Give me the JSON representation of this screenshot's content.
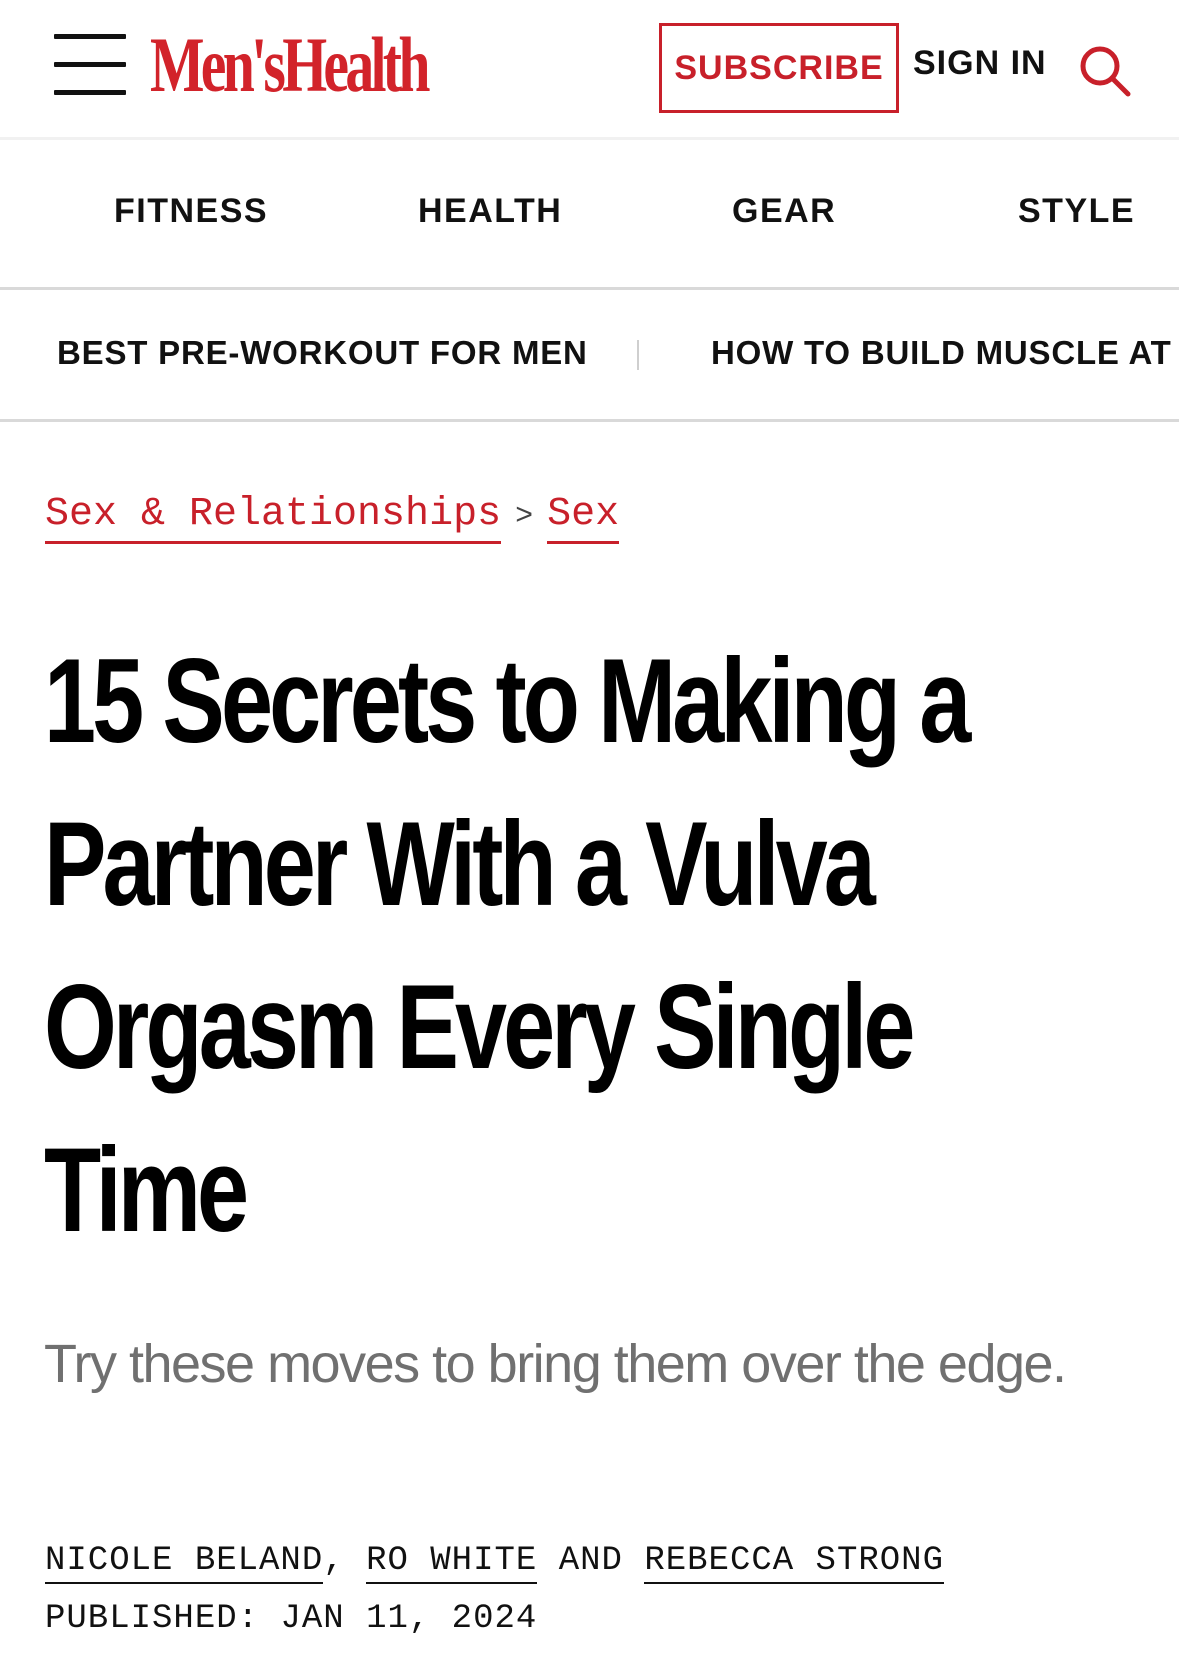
{
  "header": {
    "logo": "Men'sHealth",
    "subscribe_label": "SUBSCRIBE",
    "signin_label": "SIGN IN"
  },
  "primary_nav": [
    "FITNESS",
    "HEALTH",
    "GEAR",
    "STYLE"
  ],
  "trending_nav": [
    "BEST PRE-WORKOUT FOR MEN",
    "HOW TO BUILD MUSCLE AT"
  ],
  "breadcrumb": {
    "parent": "Sex & Relationships",
    "separator": ">",
    "current": "Sex"
  },
  "article": {
    "title": "15 Secrets to Making a Partner With a Vulva Orgasm Every Single Time",
    "dek": "Try these moves to bring them over the edge.",
    "authors": [
      "NICOLE BELAND",
      "RO WHITE",
      "REBECCA STRONG"
    ],
    "author_sep_1": ",",
    "author_sep_2": "AND",
    "published_label": "PUBLISHED:",
    "published_date": "JAN 11, 2024"
  },
  "colors": {
    "brand_red": "#c8202a",
    "dek_gray": "#707070"
  }
}
